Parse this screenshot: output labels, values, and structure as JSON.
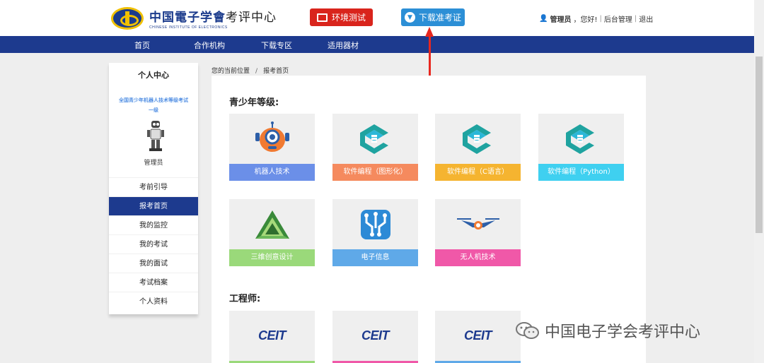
{
  "header": {
    "logo_cn": "中国電子学會",
    "logo_suffix": "考评中心",
    "logo_en": "CHINESE INSTITUTE OF ELECTRONICS",
    "env_test_label": "环境测试",
    "download_ticket_label": "下载准考证",
    "user_name": "管理员",
    "greeting": "，您好!",
    "sep1": "|",
    "admin_link": "后台管理",
    "sep2": "|",
    "logout_link": "退出"
  },
  "nav": {
    "items": [
      {
        "label": "首页"
      },
      {
        "label": "合作机构"
      },
      {
        "label": "下载专区"
      },
      {
        "label": "适用器材"
      }
    ]
  },
  "sidebar": {
    "title": "个人中心",
    "exam_line1": "全国青少年机器人技术等级考试",
    "exam_line2": "一级",
    "user_label": "管理员",
    "items": [
      {
        "label": "考前引导"
      },
      {
        "label": "报考首页"
      },
      {
        "label": "我的监控"
      },
      {
        "label": "我的考试"
      },
      {
        "label": "我的面试"
      },
      {
        "label": "考试档案"
      },
      {
        "label": "个人资料"
      }
    ]
  },
  "breadcrumb": {
    "current": "您的当前位置",
    "slash": "/",
    "page": "报考首页"
  },
  "main": {
    "youth_title": "青少年等级:",
    "engineer_title": "工程师:",
    "youth_cards": [
      {
        "label": "机器人技术",
        "color": "#6b8fe8",
        "icon": "robot-icon"
      },
      {
        "label": "软件编程（图形化）",
        "color": "#f58a5e",
        "icon": "code-logo-icon"
      },
      {
        "label": "软件编程（C语言）",
        "color": "#f5b430",
        "icon": "code-logo-icon"
      },
      {
        "label": "软件编程（Python）",
        "color": "#3fd0f0",
        "icon": "code-logo-icon"
      },
      {
        "label": "三维创意设计",
        "color": "#9ad97a",
        "icon": "triangle-3d-icon"
      },
      {
        "label": "电子信息",
        "color": "#5fa9e8",
        "icon": "circuit-icon"
      },
      {
        "label": "无人机技术",
        "color": "#f058a8",
        "icon": "drone-icon"
      }
    ],
    "engineer_cards": [
      {
        "logo": "CEIT",
        "color": "#9ad97a"
      },
      {
        "logo": "CEIT",
        "color": "#f058a8"
      },
      {
        "logo": "CEIT",
        "color": "#5fa9e8"
      }
    ]
  },
  "watermark": {
    "text": "中国电子学会考评中心"
  },
  "colors": {
    "nav_bg": "#1d3a8e",
    "env_btn": "#d9241c",
    "download_btn": "#2c8fd6",
    "arrow": "#e8271f"
  }
}
